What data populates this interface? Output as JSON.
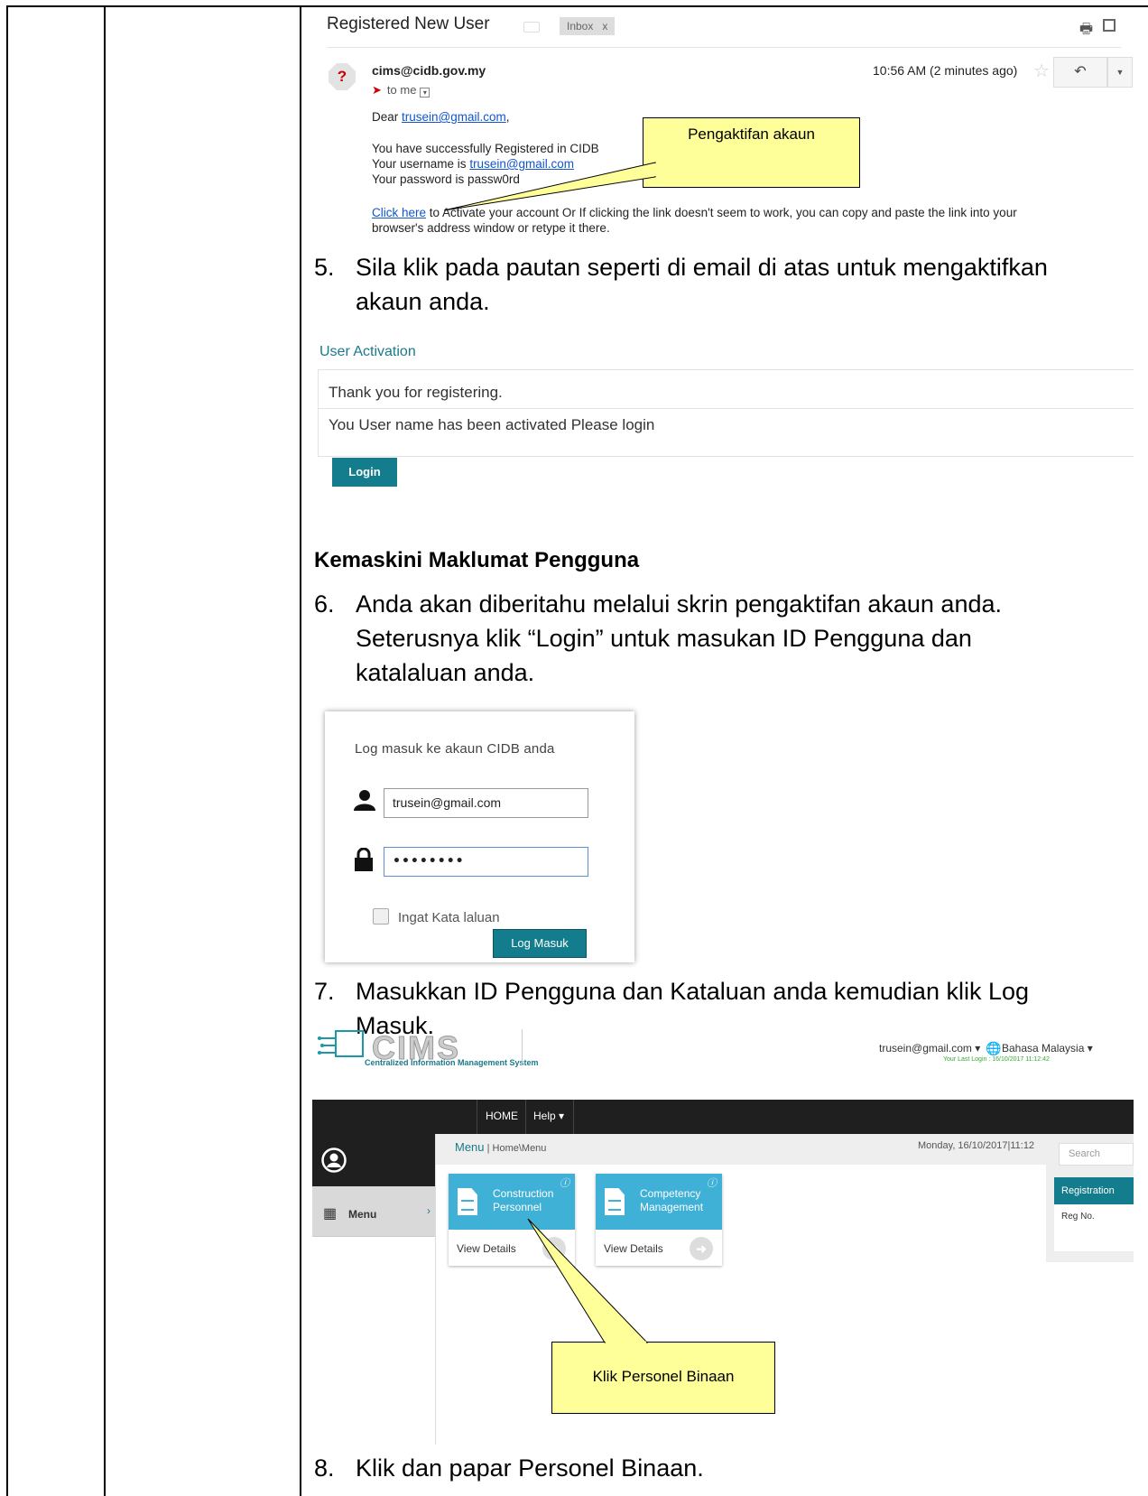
{
  "email": {
    "subject": "Registered New User",
    "inbox_label": "Inbox",
    "inbox_close": "x",
    "sender": "cims@cidb.gov.my",
    "to_me": "to me",
    "time": "10:56 AM (2 minutes ago)",
    "dear_prefix": "Dear ",
    "dear_email": "trusein@gmail.com",
    "dear_suffix": ",",
    "line_success": "You have successfully Registered in CIDB",
    "username_prefix": "Your username is ",
    "username_email": "trusein@gmail.com",
    "password_line": "Your password is passw0rd",
    "click_here": "Click here",
    "activate_text_1": " to Activate your account Or If clicking the link doesn't seem to work, you can copy and paste the link into your",
    "activate_text_2": "browser's address window or retype it there."
  },
  "callouts": {
    "activation": "Pengaktifan akaun",
    "personnel": "Klik Personel Binaan"
  },
  "steps": {
    "s5_num": "5.",
    "s5_line1": "Sila klik pada pautan seperti di email di atas untuk mengaktifkan",
    "s5_line2": "akaun anda.",
    "heading": "Kemaskini Maklumat Pengguna",
    "s6_num": "6.",
    "s6_line1": "Anda akan diberitahu melalui skrin pengaktifan akaun anda.",
    "s6_line2": "Seterusnya klik “Login” untuk masukan ID Pengguna dan",
    "s6_line3": "katalaluan anda.",
    "s7_num": "7.",
    "s7_line1": "Masukkan ID Pengguna dan Kataluan anda kemudian klik Log",
    "s7_line2": "Masuk.",
    "s8_num": "8.",
    "s8_line1": "Klik dan papar Personel Binaan."
  },
  "activation": {
    "title": "User Activation",
    "thanks": "Thank you for registering.",
    "activated": "You User name has been activated Please login",
    "login_button": "Login"
  },
  "login_card": {
    "title": "Log masuk ke akaun CIDB anda",
    "username_value": "trusein@gmail.com",
    "password_value": "••••••••",
    "remember_label": "Ingat Kata laluan",
    "submit_button": "Log Masuk"
  },
  "cims": {
    "logo_text": "CIMS",
    "logo_subtitle": "Centralized Information Management System",
    "user": "trusein@gmail.com ▾",
    "language": "Bahasa Malaysia ▾",
    "last_login": "Your Last Login : 16/10/2017 11:12:42",
    "nav_home": "HOME",
    "nav_help": "Help ▾",
    "sidebar_menu": "Menu",
    "crumb_title": "Menu",
    "crumb_path": " | Home\\Menu",
    "date": "Monday, 16/10/2017|11:12",
    "search_placeholder": "Search",
    "registration_title": "Registration",
    "reg_no": "Reg No.",
    "tiles": [
      {
        "line1": "Construction",
        "line2": "Personnel",
        "view": "View Details"
      },
      {
        "line1": "Competency",
        "line2": "Management",
        "view": "View Details"
      }
    ]
  }
}
